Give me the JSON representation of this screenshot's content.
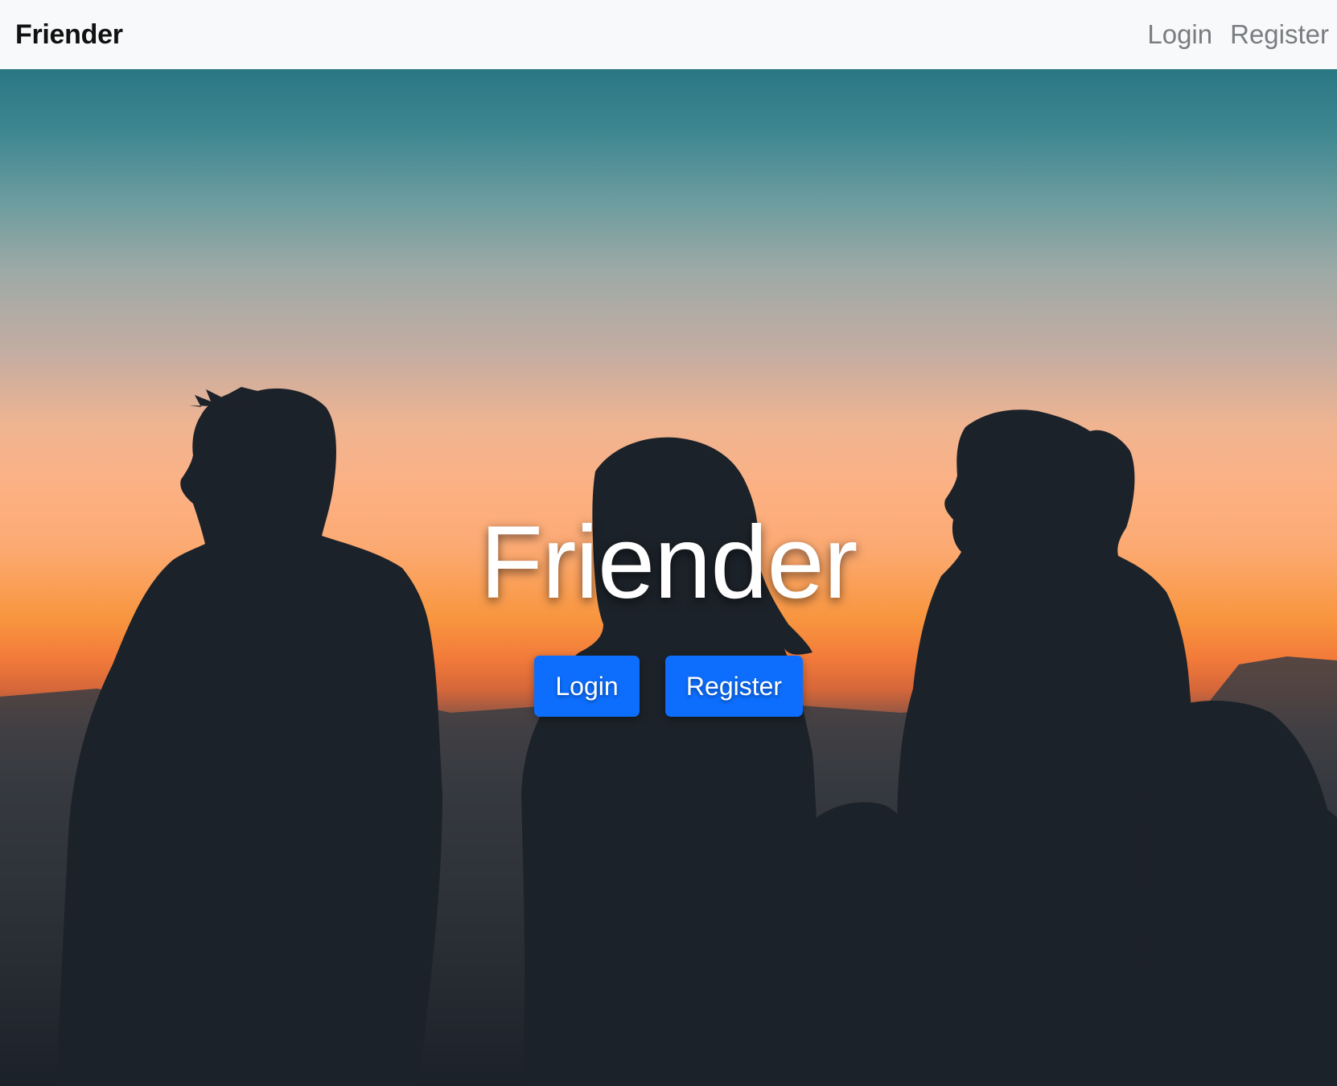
{
  "navbar": {
    "brand": "Friender",
    "links": {
      "login": "Login",
      "register": "Register"
    }
  },
  "hero": {
    "title": "Friender",
    "buttons": {
      "login": "Login",
      "register": "Register"
    },
    "background_image": "silhouettes-of-three-people-at-sunset",
    "button_color": "#0d6efd"
  }
}
